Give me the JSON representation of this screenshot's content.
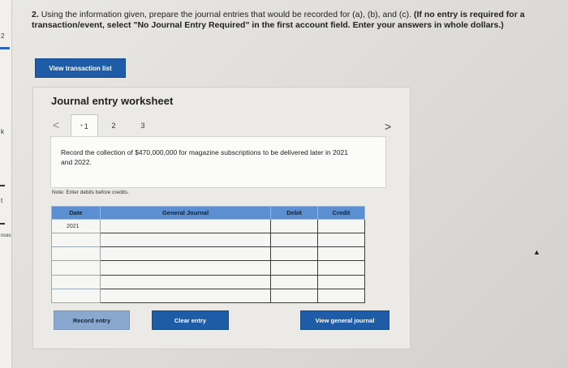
{
  "sidebar": {
    "items": [
      {
        "label": "2"
      },
      {
        "label": "k"
      },
      {
        "label": "t"
      },
      {
        "label": "nces"
      }
    ]
  },
  "question": {
    "number": "2.",
    "text": "Using the information given, prepare the journal entries that would be recorded for (a), (b), and (c).",
    "instruction": "(If no entry is required for a transaction/event, select \"No Journal Entry Required\" in the first account field. Enter your answers in whole dollars.)"
  },
  "buttons": {
    "view_transaction_list": "View transaction list",
    "record_entry": "Record entry",
    "clear_entry": "Clear entry",
    "view_general_journal": "View general journal"
  },
  "worksheet": {
    "title": "Journal entry worksheet",
    "tabs": [
      "1",
      "2",
      "3"
    ],
    "active_tab": "1",
    "prev_glyph": "<",
    "next_glyph": ">",
    "description": "Record the collection of $470,000,000 for magazine subscriptions to be delivered later in 2021 and 2022.",
    "note": "Note: Enter debits before credits."
  },
  "journal_table": {
    "headers": {
      "date": "Date",
      "account": "General Journal",
      "debit": "Debit",
      "credit": "Credit"
    },
    "rows": [
      {
        "date": "2021",
        "account": "",
        "debit": "",
        "credit": ""
      },
      {
        "date": "",
        "account": "",
        "debit": "",
        "credit": ""
      },
      {
        "date": "",
        "account": "",
        "debit": "",
        "credit": ""
      },
      {
        "date": "",
        "account": "",
        "debit": "",
        "credit": ""
      },
      {
        "date": "",
        "account": "",
        "debit": "",
        "credit": ""
      },
      {
        "date": "",
        "account": "",
        "debit": "",
        "credit": ""
      }
    ]
  }
}
